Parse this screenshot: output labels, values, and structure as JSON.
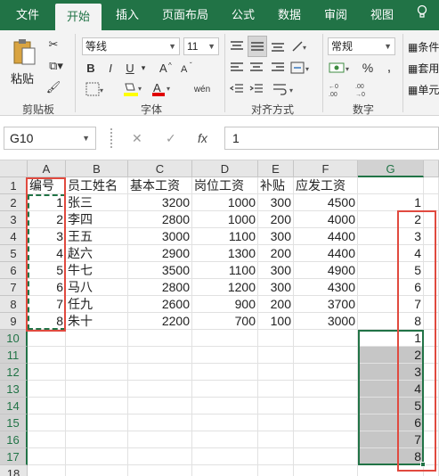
{
  "tabs": [
    {
      "label": "文件",
      "active": false
    },
    {
      "label": "开始",
      "active": true
    },
    {
      "label": "插入",
      "active": false
    },
    {
      "label": "页面布局",
      "active": false
    },
    {
      "label": "公式",
      "active": false
    },
    {
      "label": "数据",
      "active": false
    },
    {
      "label": "审阅",
      "active": false
    },
    {
      "label": "视图",
      "active": false
    }
  ],
  "ribbon": {
    "paste_label": "粘贴",
    "clipboard_label": "剪贴板",
    "font_name": "等线",
    "font_size": "11",
    "font_label": "字体",
    "align_label": "对齐方式",
    "number_format": "常规",
    "number_label": "数字",
    "cond_format": "条件",
    "table_format": "套用",
    "cell_style": "单元",
    "percent": "%",
    "comma": ",",
    "wen": "wén",
    "bold": "B",
    "italic": "I",
    "underline": "U"
  },
  "formula_bar": {
    "name_box": "G10",
    "cancel": "✕",
    "confirm": "✓",
    "fx": "fx",
    "value": "1"
  },
  "columns": [
    "A",
    "B",
    "C",
    "D",
    "E",
    "F",
    "G"
  ],
  "selected_column": "G",
  "rows": [
    [
      "编号",
      "员工姓名",
      "基本工资",
      "岗位工资",
      "补贴",
      "应发工资",
      ""
    ],
    [
      "1",
      "张三",
      "3200",
      "1000",
      "300",
      "4500",
      "1"
    ],
    [
      "2",
      "李四",
      "2800",
      "1000",
      "200",
      "4000",
      "2"
    ],
    [
      "3",
      "王五",
      "3000",
      "1100",
      "300",
      "4400",
      "3"
    ],
    [
      "4",
      "赵六",
      "2900",
      "1300",
      "200",
      "4400",
      "4"
    ],
    [
      "5",
      "牛七",
      "3500",
      "1100",
      "300",
      "4900",
      "5"
    ],
    [
      "6",
      "马八",
      "2800",
      "1200",
      "300",
      "4300",
      "6"
    ],
    [
      "7",
      "任九",
      "2600",
      "900",
      "200",
      "3700",
      "7"
    ],
    [
      "8",
      "朱十",
      "2200",
      "700",
      "100",
      "3000",
      "8"
    ],
    [
      "",
      "",
      "",
      "",
      "",
      "",
      "1"
    ],
    [
      "",
      "",
      "",
      "",
      "",
      "",
      "2"
    ],
    [
      "",
      "",
      "",
      "",
      "",
      "",
      "3"
    ],
    [
      "",
      "",
      "",
      "",
      "",
      "",
      "4"
    ],
    [
      "",
      "",
      "",
      "",
      "",
      "",
      "5"
    ],
    [
      "",
      "",
      "",
      "",
      "",
      "",
      "6"
    ],
    [
      "",
      "",
      "",
      "",
      "",
      "",
      "7"
    ],
    [
      "",
      "",
      "",
      "",
      "",
      "",
      "8"
    ],
    [
      "",
      "",
      "",
      "",
      "",
      "",
      ""
    ]
  ],
  "row_numbers": [
    "1",
    "2",
    "3",
    "4",
    "5",
    "6",
    "7",
    "8",
    "9",
    "10",
    "11",
    "12",
    "13",
    "14",
    "15",
    "16",
    "17",
    "18"
  ],
  "colors": {
    "accent": "#217346",
    "highlight_box": "#e04a3f",
    "selection_fill": "#c6c6c6"
  }
}
